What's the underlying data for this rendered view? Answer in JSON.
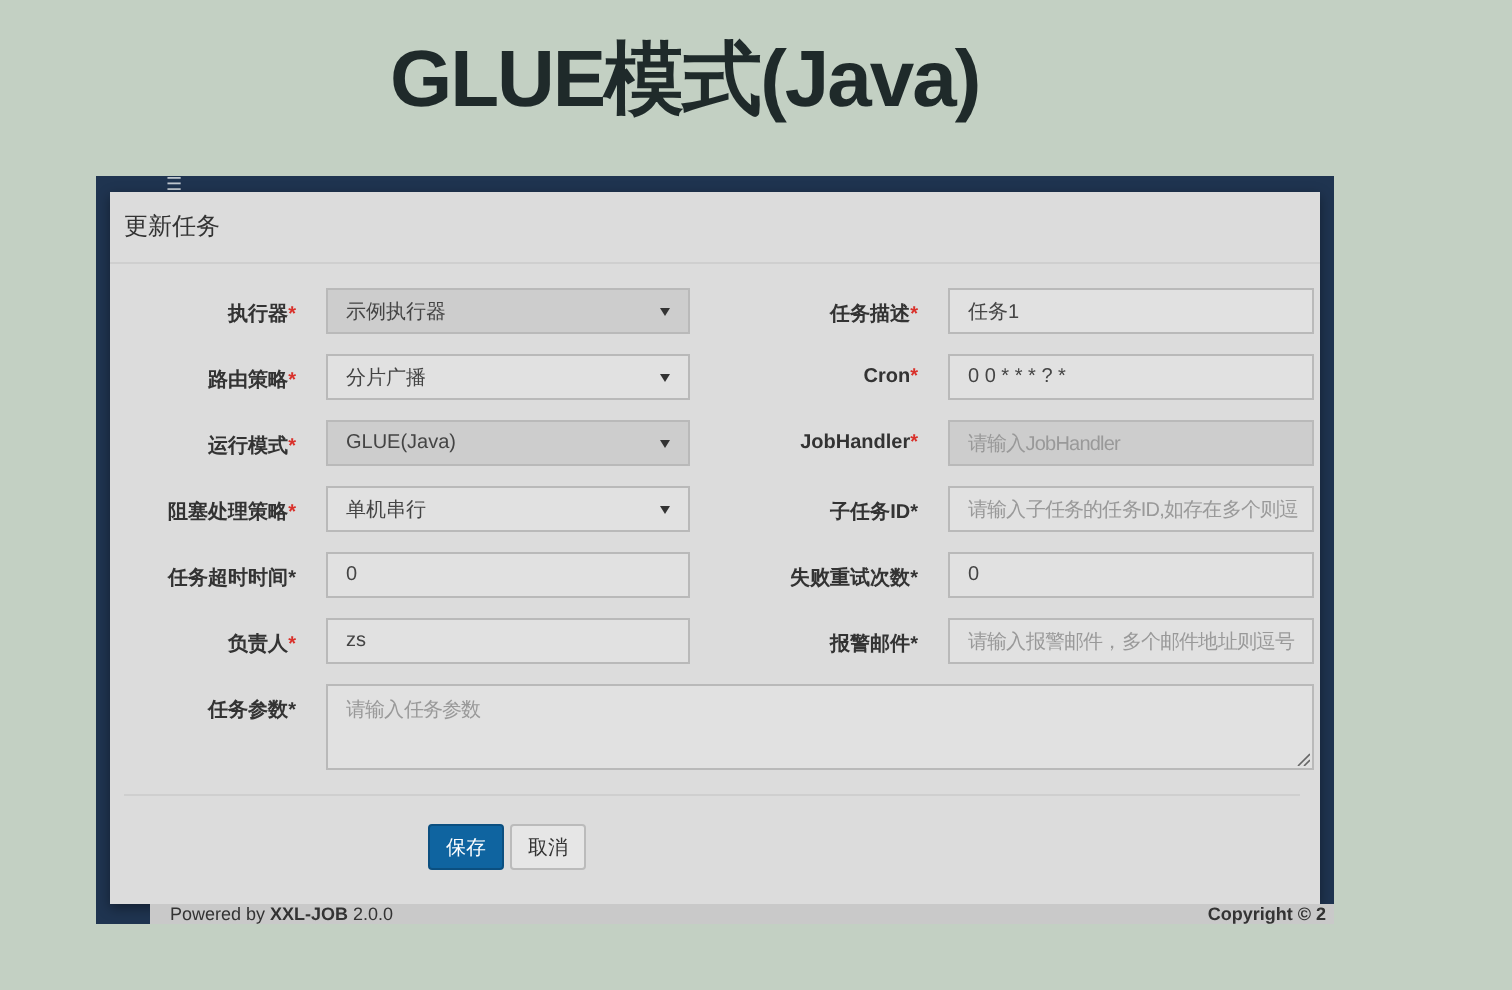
{
  "slide_title": "GLUE模式(Java)",
  "topbar": {
    "menu_glyph": "☰"
  },
  "modal": {
    "title": "更新任务",
    "fields": [
      {
        "label": "执行器",
        "asterisk": "*",
        "color": "#d9302a",
        "kind": "select",
        "value": "示例执行器",
        "disabled": true
      },
      {
        "label": "任务描述",
        "asterisk": "*",
        "color": "#d9302a",
        "kind": "input",
        "value": "任务1",
        "disabled": false
      },
      {
        "label": "路由策略",
        "asterisk": "*",
        "color": "#d9302a",
        "kind": "select",
        "value": "分片广播",
        "disabled": false
      },
      {
        "label": "Cron",
        "asterisk": "*",
        "color": "#d9302a",
        "kind": "input",
        "value": "0 0 * * * ? *",
        "disabled": false
      },
      {
        "label": "运行模式",
        "asterisk": "*",
        "color": "#d9302a",
        "kind": "select",
        "value": "GLUE(Java)",
        "disabled": true
      },
      {
        "label": "JobHandler",
        "asterisk": "*",
        "color": "#d9302a",
        "kind": "input",
        "placeholder": "请输入JobHandler",
        "disabled": true
      },
      {
        "label": "阻塞处理策略",
        "asterisk": "*",
        "color": "#d9302a",
        "kind": "select",
        "value": "单机串行",
        "disabled": false
      },
      {
        "label": "子任务ID",
        "asterisk": "*",
        "color": "#333333",
        "kind": "input",
        "placeholder": "请输入子任务的任务ID,如存在多个则逗",
        "disabled": false
      },
      {
        "label": "任务超时时间",
        "asterisk": "*",
        "color": "#333333",
        "kind": "input",
        "value": "0",
        "disabled": false
      },
      {
        "label": "失败重试次数",
        "asterisk": "*",
        "color": "#333333",
        "kind": "input",
        "value": "0",
        "disabled": false
      },
      {
        "label": "负责人",
        "asterisk": "*",
        "color": "#d9302a",
        "kind": "input",
        "value": "zs",
        "disabled": false
      },
      {
        "label": "报警邮件",
        "asterisk": "*",
        "color": "#333333",
        "kind": "input",
        "placeholder": "请输入报警邮件，多个邮件地址则逗号",
        "disabled": false
      },
      {
        "label": "任务参数",
        "asterisk": "*",
        "color": "#333333",
        "kind": "textarea",
        "placeholder": "请输入任务参数",
        "disabled": false
      }
    ],
    "buttons": [
      {
        "label": "保存",
        "kind": "primary"
      },
      {
        "label": "取消",
        "kind": "default"
      }
    ]
  },
  "footer": {
    "left": "Powered by ",
    "brand": "XXL-JOB",
    "version": " 2.0.0",
    "right": "Copyright © 2"
  }
}
